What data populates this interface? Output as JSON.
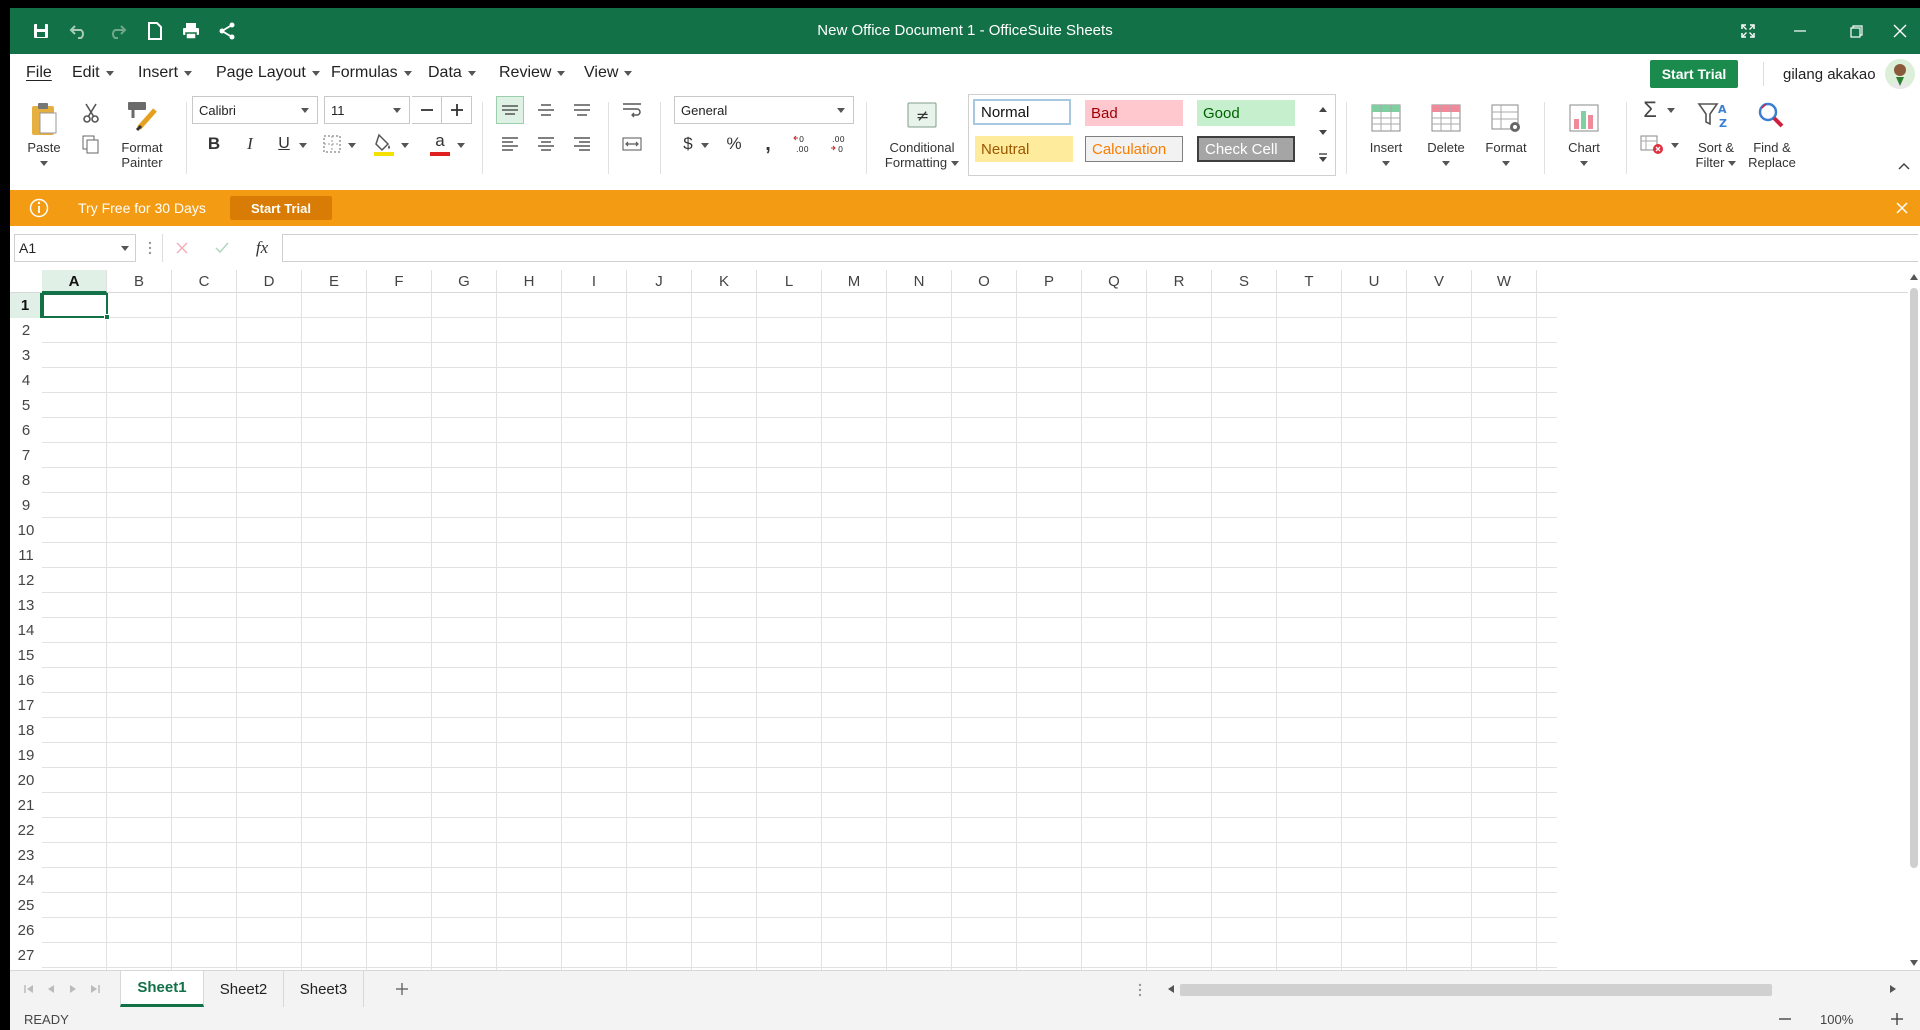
{
  "window": {
    "title": "New Office Document 1 - OfficeSuite Sheets"
  },
  "menu": {
    "items": [
      "File",
      "Edit",
      "Insert",
      "Page Layout",
      "Formulas",
      "Data",
      "Review",
      "View"
    ],
    "start_trial": "Start Trial",
    "user_name": "gilang akakao"
  },
  "ribbon": {
    "paste": "Paste",
    "format_painter_1": "Format",
    "format_painter_2": "Painter",
    "font_name": "Calibri",
    "font_size": "11",
    "number_format": "General",
    "conditional_1": "Conditional",
    "conditional_2": "Formatting",
    "styles": {
      "normal": "Normal",
      "bad": "Bad",
      "good": "Good",
      "neutral": "Neutral",
      "calculation": "Calculation",
      "check_cell": "Check Cell"
    },
    "insert": "Insert",
    "delete": "Delete",
    "format": "Format",
    "chart": "Chart",
    "sort_1": "Sort &",
    "sort_2": "Filter",
    "find_1": "Find &",
    "find_2": "Replace"
  },
  "promo": {
    "text": "Try Free for 30 Days",
    "button": "Start Trial"
  },
  "formula_bar": {
    "name_box": "A1",
    "fx": "fx",
    "value": ""
  },
  "grid": {
    "columns": [
      "A",
      "B",
      "C",
      "D",
      "E",
      "F",
      "G",
      "H",
      "I",
      "J",
      "K",
      "L",
      "M",
      "N",
      "O",
      "P",
      "Q",
      "R",
      "S",
      "T",
      "U",
      "V",
      "W"
    ],
    "rows": [
      "1",
      "2",
      "3",
      "4",
      "5",
      "6",
      "7",
      "8",
      "9",
      "10",
      "11",
      "12",
      "13",
      "14",
      "15",
      "16",
      "17",
      "18",
      "19",
      "20",
      "21",
      "22",
      "23",
      "24",
      "25",
      "26",
      "27"
    ],
    "active_cell": "A1"
  },
  "sheets": {
    "tabs": [
      "Sheet1",
      "Sheet2",
      "Sheet3"
    ],
    "active": "Sheet1"
  },
  "status": {
    "state": "READY",
    "zoom": "100%"
  },
  "colors": {
    "brand_green": "#137147",
    "promo_orange": "#f39b12"
  }
}
